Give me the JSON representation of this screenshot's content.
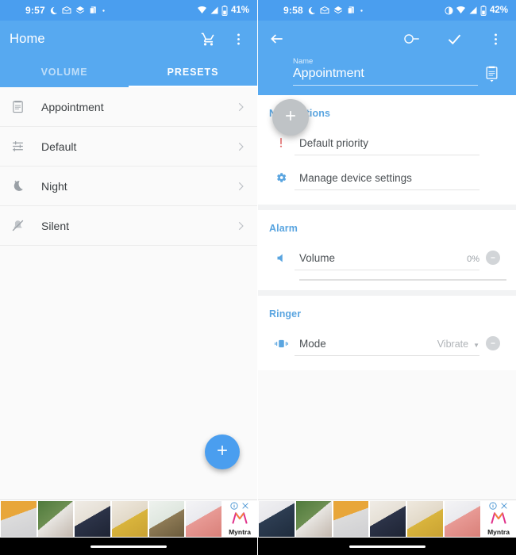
{
  "left": {
    "status_bar": {
      "time": "9:57",
      "battery_percent": "41%",
      "icons": [
        "moon-icon",
        "mail-icon",
        "layers-icon",
        "copy-icon",
        "dot-icon"
      ],
      "right_icons": [
        "wifi-icon",
        "signal-icon",
        "battery-icon"
      ]
    },
    "appbar": {
      "title": "Home",
      "actions": [
        "cart-icon",
        "overflow-menu-icon"
      ]
    },
    "tabs": [
      {
        "label": "VOLUME",
        "active": false
      },
      {
        "label": "PRESETS",
        "active": true
      }
    ],
    "presets": [
      {
        "label": "Appointment",
        "icon": "clipboard-icon"
      },
      {
        "label": "Default",
        "icon": "tune-icon"
      },
      {
        "label": "Night",
        "icon": "moon-icon"
      },
      {
        "label": "Silent",
        "icon": "bell-off-icon"
      }
    ],
    "fab": {
      "icon": "plus-icon"
    },
    "ad": {
      "brand": "Myntra",
      "info_icon": "info-icon",
      "close_icon": "close-icon"
    }
  },
  "right": {
    "status_bar": {
      "time": "9:58",
      "battery_percent": "42%",
      "icons": [
        "moon-icon",
        "mail-icon",
        "layers-icon",
        "copy-icon",
        "dot-icon"
      ],
      "right_icons": [
        "contrast-icon",
        "wifi-icon",
        "signal-icon",
        "battery-icon"
      ]
    },
    "appbar": {
      "back": "back-arrow-icon",
      "toggle": "toggle-switch-icon",
      "confirm": "check-icon",
      "overflow": "overflow-menu-icon"
    },
    "name_field": {
      "caption": "Name",
      "value": "Appointment",
      "side_icon": "clipboard-dropdown-icon"
    },
    "fab": {
      "icon": "plus-icon"
    },
    "sections": [
      {
        "title": "Notifications",
        "rows": [
          {
            "icon": "priority-icon",
            "label": "Default priority",
            "value": "",
            "minus": false,
            "slider": false,
            "caret": false
          },
          {
            "icon": "gear-icon",
            "label": "Manage device settings",
            "value": "",
            "minus": false,
            "slider": false,
            "caret": false
          }
        ]
      },
      {
        "title": "Alarm",
        "rows": [
          {
            "icon": "volume-icon",
            "label": "Volume",
            "value": "0%",
            "minus": true,
            "slider": true,
            "caret": false
          }
        ]
      },
      {
        "title": "Ringer",
        "rows": [
          {
            "icon": "vibrate-icon",
            "label": "Mode",
            "value": "Vibrate",
            "minus": true,
            "slider": false,
            "caret": true
          }
        ]
      }
    ],
    "ad": {
      "brand": "Myntra",
      "info_icon": "info-icon",
      "close_icon": "close-icon"
    }
  },
  "colors": {
    "primary": "#57a9f0",
    "status_bar": "#4a9eef",
    "accent": "#5aa5e0",
    "fab": "#4a9eef",
    "fab_gray": "#bfc3c6",
    "brand_pink": "#e0318a"
  }
}
